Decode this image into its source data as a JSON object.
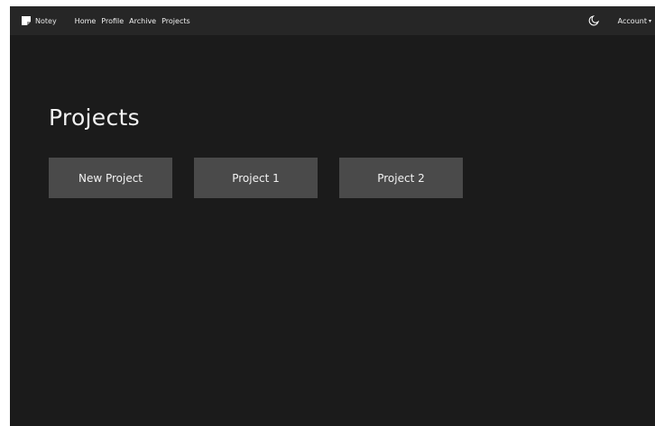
{
  "navbar": {
    "brand": "Notey",
    "links": [
      "Home",
      "Profile",
      "Archive",
      "Projects"
    ],
    "account_label": "Account",
    "account_caret": "▾"
  },
  "main": {
    "title": "Projects",
    "cards": [
      "New Project",
      "Project 1",
      "Project 2"
    ]
  },
  "colors": {
    "background": "#1b1b1b",
    "navbar": "#262626",
    "card": "#4a4a4a",
    "text": "#f2f2f2"
  },
  "icons": {
    "logo": "notey-logo-icon",
    "theme_toggle": "moon-icon"
  }
}
